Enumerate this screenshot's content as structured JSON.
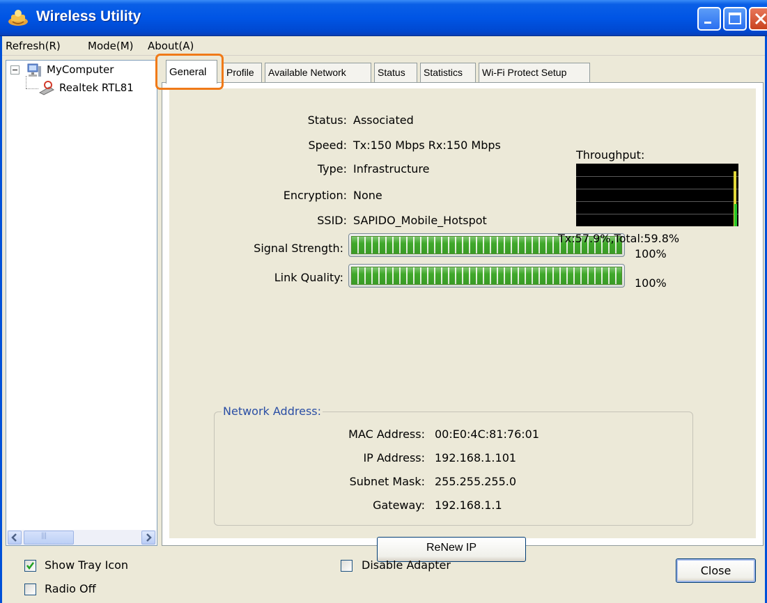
{
  "window": {
    "title": "Wireless Utility"
  },
  "menu": {
    "refresh": "Refresh(R)",
    "mode": "Mode(M)",
    "about": "About(A)"
  },
  "tree": {
    "root_label": "MyComputer",
    "adapter_label": "Realtek RTL81"
  },
  "tabs": [
    {
      "label": "General",
      "active": true
    },
    {
      "label": "Profile"
    },
    {
      "label": "Available Network"
    },
    {
      "label": "Status"
    },
    {
      "label": "Statistics"
    },
    {
      "label": "Wi-Fi Protect Setup"
    }
  ],
  "general": {
    "status_label": "Status:",
    "status_value": "Associated",
    "speed_label": "Speed:",
    "speed_value": "Tx:150 Mbps Rx:150 Mbps",
    "type_label": "Type:",
    "type_value": "Infrastructure",
    "encryption_label": "Encryption:",
    "encryption_value": "None",
    "ssid_label": "SSID:",
    "ssid_value": "SAPIDO_Mobile_Hotspot",
    "signal_label": "Signal Strength:",
    "signal_pct": "100%",
    "signal_level": 100,
    "link_label": "Link Quality:",
    "link_pct": "100%",
    "link_level": 100
  },
  "throughput": {
    "label": "Throughput:",
    "summary": "Tx:57.9%,Total:59.8%",
    "tx_pct": 57.9,
    "total_pct": 59.8
  },
  "network_address": {
    "title": "Network Address:",
    "mac_label": "MAC Address:",
    "mac_value": "00:E0:4C:81:76:01",
    "ip_label": "IP Address:",
    "ip_value": "192.168.1.101",
    "subnet_label": "Subnet Mask:",
    "subnet_value": "255.255.255.0",
    "gateway_label": "Gateway:",
    "gateway_value": "192.168.1.1"
  },
  "buttons": {
    "renew_ip": "ReNew IP",
    "close": "Close"
  },
  "options": {
    "show_tray_icon": "Show Tray Icon",
    "show_tray_icon_checked": true,
    "radio_off": "Radio Off",
    "radio_off_checked": false,
    "disable_adapter": "Disable Adapter",
    "disable_adapter_checked": false
  },
  "colors": {
    "titlebar": "#0055e5",
    "bar_green": "#3fa82a",
    "highlight_orange": "#f07a18",
    "group_title_blue": "#2a4ea4"
  }
}
